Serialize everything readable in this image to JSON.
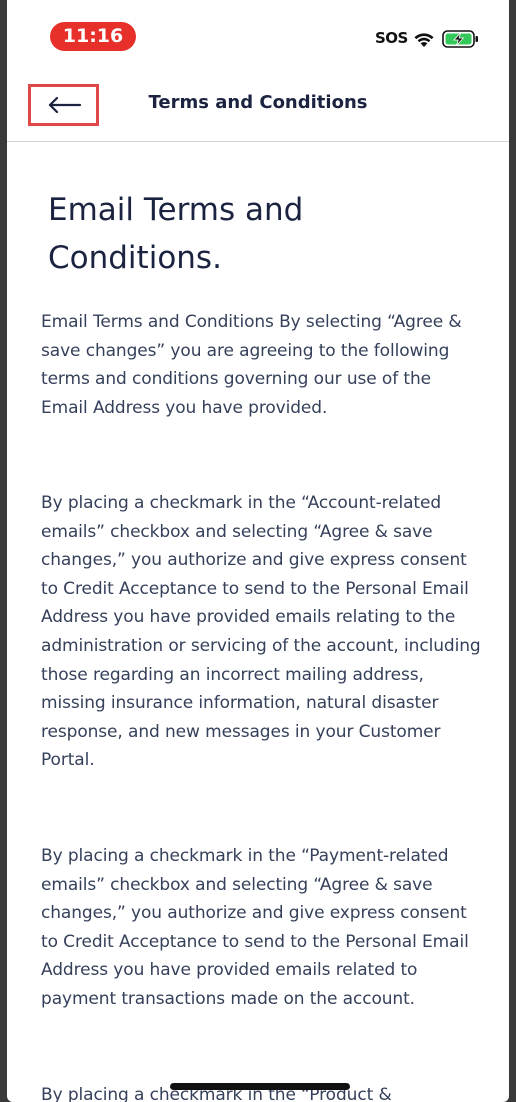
{
  "status_bar": {
    "time": "11:16",
    "sos": "SOS",
    "wifi_icon": "wifi-icon",
    "battery_icon": "battery-charging-icon",
    "time_pill_color": "#e8302a",
    "battery_color": "#34c759"
  },
  "header": {
    "back_icon": "arrow-left-icon",
    "title": "Terms and Conditions"
  },
  "content": {
    "title": "Email Terms and Conditions.",
    "paragraphs": [
      "Email Terms and Conditions By selecting “Agree & save changes” you are agreeing to the following terms and conditions governing our use of the Email Address you have provided.",
      "By placing a checkmark in the “Account-related emails” checkbox and selecting “Agree & save changes,” you authorize and give express consent to Credit Acceptance to send to the Personal Email Address you have provided emails relating to the administration or servicing of the account, including those regarding an incorrect mailing address, missing insurance information, natural disaster response, and new messages in your Customer Portal.",
      "By placing a checkmark in the “Payment-related emails” checkbox and selecting “Agree & save changes,” you authorize and give express consent to Credit Acceptance to send to the Personal Email Address you have provided emails related to payment transactions made on the account.",
      "By placing a checkmark in the “Product &"
    ]
  },
  "colors": {
    "title_text": "#1b2340",
    "body_text": "#35405a",
    "highlight_border": "#e04848"
  }
}
